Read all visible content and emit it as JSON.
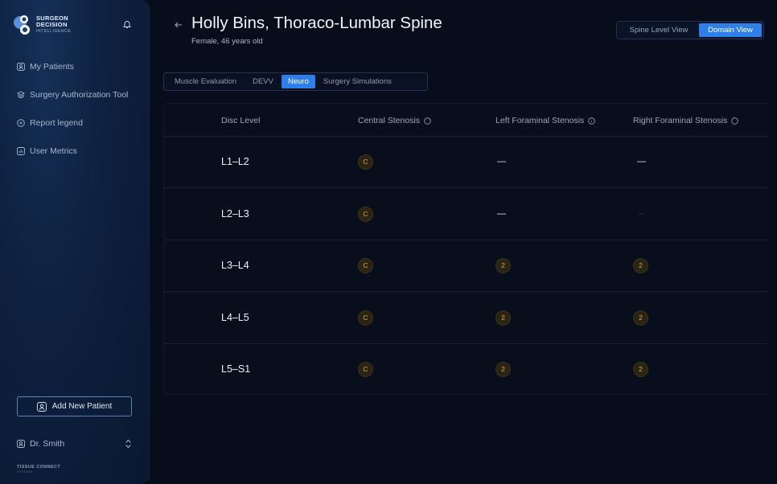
{
  "brand": {
    "line1": "SURGEON",
    "line2": "DECISION",
    "line3": "INTELLIGENCE"
  },
  "sidebar": {
    "items": [
      {
        "label": "My Patients",
        "icon": "patients-icon"
      },
      {
        "label": "Surgery Authorization Tool",
        "icon": "layers-icon"
      },
      {
        "label": "Report legend",
        "icon": "legend-icon"
      },
      {
        "label": "User Metrics",
        "icon": "metrics-icon"
      }
    ],
    "add_patient": "Add New Patient",
    "user_name": "Dr. Smith",
    "footer_brand": "TISSUE CONNECT",
    "footer_sub": "SYSTEMS"
  },
  "header": {
    "title": "Holly Bins, Thoraco-Lumbar Spine",
    "subtitle": "Female, 46 years old",
    "view_toggle": {
      "spine": "Spine Level View",
      "domain": "Domain View",
      "selected": "Domain View"
    }
  },
  "tabs": [
    {
      "label": "Muscle Evaluation",
      "active": false
    },
    {
      "label": "DEVV",
      "active": false
    },
    {
      "label": "Neuro",
      "active": true
    },
    {
      "label": "Surgery Simulations",
      "active": false
    }
  ],
  "table": {
    "columns": [
      "Disc Level",
      "Central Stenosis",
      "Left Foraminal Stenosis",
      "Right Foraminal Stenosis"
    ],
    "rows": [
      {
        "level": "L1–L2",
        "central": "C",
        "left": "—",
        "right": "—"
      },
      {
        "level": "L2–L3",
        "central": "C",
        "left": "—",
        "right": "–"
      },
      {
        "level": "L3–L4",
        "central": "C",
        "left": "2",
        "right": "2"
      },
      {
        "level": "L4–L5",
        "central": "C",
        "left": "2",
        "right": "2"
      },
      {
        "level": "L5–S1",
        "central": "C",
        "left": "2",
        "right": "2"
      }
    ]
  },
  "colors": {
    "accent": "#2f7fea",
    "badge_text": "#e8a33a",
    "background": "#080d1b"
  }
}
